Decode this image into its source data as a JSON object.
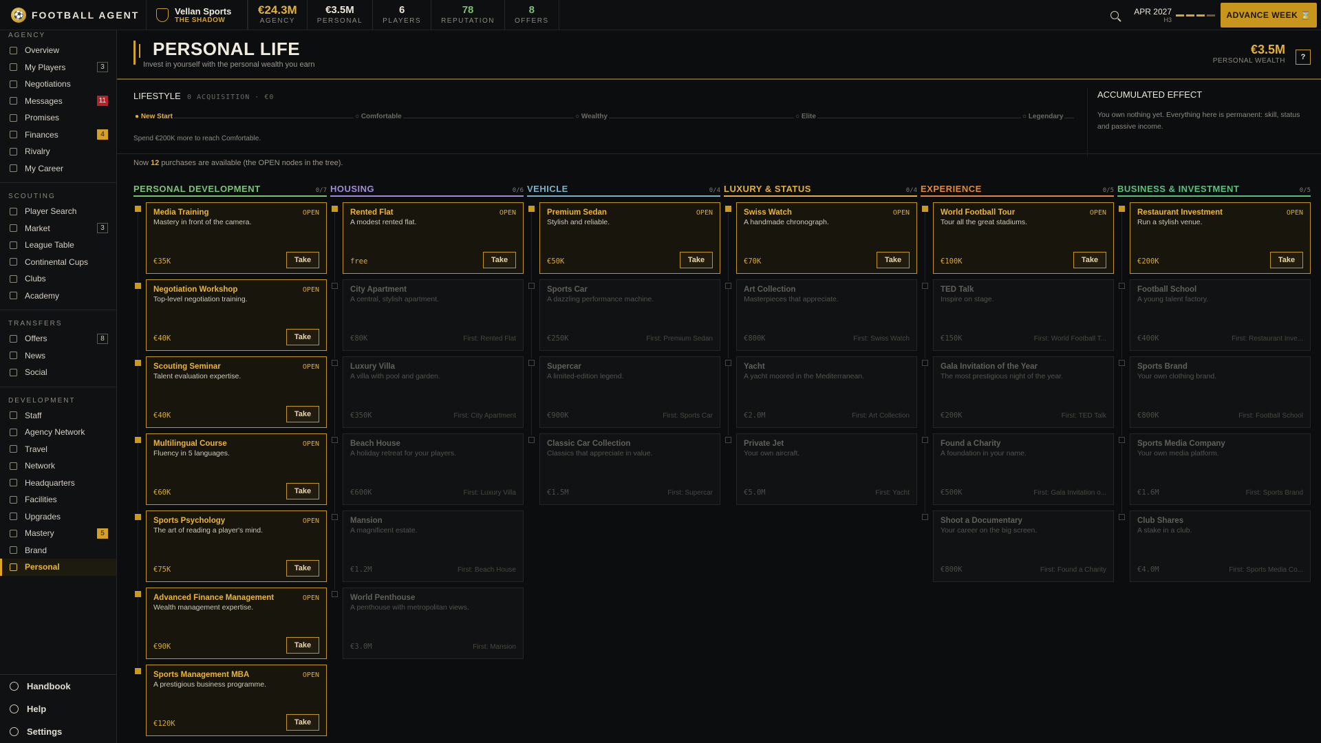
{
  "app": {
    "name": "FOOTBALL AGENT"
  },
  "agency": {
    "name": "Vellan Sports",
    "alias": "THE SHADOW"
  },
  "stats": [
    {
      "value": "€24.3M",
      "label": "AGENCY",
      "style": "gold"
    },
    {
      "value": "€3.5M",
      "label": "PERSONAL",
      "style": ""
    },
    {
      "value": "6",
      "label": "PLAYERS",
      "style": ""
    },
    {
      "value": "78",
      "label": "REPUTATION",
      "style": "green"
    },
    {
      "value": "8",
      "label": "OFFERS",
      "style": "green"
    }
  ],
  "date": {
    "main": "APR 2027",
    "sub": "H3"
  },
  "advance_label": "ADVANCE WEEK",
  "sidebar": {
    "sections": [
      {
        "title": "AGENCY",
        "items": [
          {
            "label": "Overview",
            "icon": "grid-icon"
          },
          {
            "label": "My Players",
            "icon": "user-icon",
            "badge": "3"
          },
          {
            "label": "Negotiations",
            "icon": "chat-icon"
          },
          {
            "label": "Messages",
            "icon": "mail-icon",
            "badge": "11",
            "badge_style": "red"
          },
          {
            "label": "Promises",
            "icon": "link-icon"
          },
          {
            "label": "Finances",
            "icon": "coin-icon",
            "badge": "4",
            "badge_style": "gold"
          },
          {
            "label": "Rivalry",
            "icon": "swords-icon"
          },
          {
            "label": "My Career",
            "icon": "medal-icon"
          }
        ]
      },
      {
        "title": "SCOUTING",
        "items": [
          {
            "label": "Player Search",
            "icon": "search-icon"
          },
          {
            "label": "Market",
            "icon": "cart-icon",
            "badge": "3"
          },
          {
            "label": "League Table",
            "icon": "table-icon"
          },
          {
            "label": "Continental Cups",
            "icon": "trophy-icon"
          },
          {
            "label": "Clubs",
            "icon": "shield-icon"
          },
          {
            "label": "Academy",
            "icon": "cap-icon"
          }
        ]
      },
      {
        "title": "TRANSFERS",
        "items": [
          {
            "label": "Offers",
            "icon": "transfer-icon",
            "badge": "8"
          },
          {
            "label": "News",
            "icon": "globe-icon"
          },
          {
            "label": "Social",
            "icon": "social-icon"
          }
        ]
      },
      {
        "title": "DEVELOPMENT",
        "items": [
          {
            "label": "Staff",
            "icon": "staff-icon"
          },
          {
            "label": "Agency Network",
            "icon": "network-icon"
          },
          {
            "label": "Travel",
            "icon": "plane-icon"
          },
          {
            "label": "Network",
            "icon": "nodes-icon"
          },
          {
            "label": "Headquarters",
            "icon": "building-icon"
          },
          {
            "label": "Facilities",
            "icon": "dumbbell-icon"
          },
          {
            "label": "Upgrades",
            "icon": "trend-icon"
          },
          {
            "label": "Mastery",
            "icon": "chevrons-icon",
            "badge": "5",
            "badge_style": "gold"
          },
          {
            "label": "Brand",
            "icon": "star-icon"
          },
          {
            "label": "Personal",
            "icon": "gem-icon",
            "active": true
          }
        ]
      }
    ],
    "bottom": [
      {
        "label": "Handbook",
        "icon": "book-icon"
      },
      {
        "label": "Help",
        "icon": "help-icon"
      },
      {
        "label": "Settings",
        "icon": "gear-icon"
      }
    ]
  },
  "page": {
    "title": "PERSONAL LIFE",
    "subtitle": "Invest in yourself with the personal wealth you earn",
    "wealth_value": "€3.5M",
    "wealth_label": "PERSONAL WEALTH",
    "help_label": "?"
  },
  "lifestyle": {
    "title": "LIFESTYLE",
    "sub": "0 ACQUISITION · €0",
    "steps": [
      "● New Start",
      "○ Comfortable",
      "○ Wealthy",
      "○ Elite",
      "○ Legendary"
    ],
    "note": "Spend €200K more to reach Comfortable.",
    "now_prefix": "Now",
    "now_count": "12",
    "now_suffix": "purchases are available (the OPEN nodes in the tree)."
  },
  "accumulated": {
    "title": "ACCUMULATED EFFECT",
    "text": "You own nothing yet. Everything here is permanent: skill, status and passive income."
  },
  "labels": {
    "open": "OPEN",
    "take": "Take"
  },
  "columns": [
    {
      "name": "PERSONAL DEVELOPMENT",
      "count": "0/7",
      "color": "#7ec27a",
      "nodes": [
        {
          "title": "Media Training",
          "desc": "Mastery in front of the camera.",
          "price": "€35K",
          "open": true
        },
        {
          "title": "Negotiation Workshop",
          "desc": "Top-level negotiation training.",
          "price": "€40K",
          "open": true
        },
        {
          "title": "Scouting Seminar",
          "desc": "Talent evaluation expertise.",
          "price": "€40K",
          "open": true
        },
        {
          "title": "Multilingual Course",
          "desc": "Fluency in 5 languages.",
          "price": "€60K",
          "open": true
        },
        {
          "title": "Sports Psychology",
          "desc": "The art of reading a player's mind.",
          "price": "€75K",
          "open": true
        },
        {
          "title": "Advanced Finance Management",
          "desc": "Wealth management expertise.",
          "price": "€90K",
          "open": true
        },
        {
          "title": "Sports Management MBA",
          "desc": "A prestigious business programme.",
          "price": "€120K",
          "open": true
        }
      ]
    },
    {
      "name": "HOUSING",
      "count": "0/6",
      "color": "#a48bd6",
      "nodes": [
        {
          "title": "Rented Flat",
          "desc": "A modest rented flat.",
          "price": "free",
          "open": true
        },
        {
          "title": "City Apartment",
          "desc": "A central, stylish apartment.",
          "price": "€80K",
          "req": "First: Rented Flat"
        },
        {
          "title": "Luxury Villa",
          "desc": "A villa with pool and garden.",
          "price": "€350K",
          "req": "First: City Apartment"
        },
        {
          "title": "Beach House",
          "desc": "A holiday retreat for your players.",
          "price": "€600K",
          "req": "First: Luxury Villa"
        },
        {
          "title": "Mansion",
          "desc": "A magnificent estate.",
          "price": "€1.2M",
          "req": "First: Beach House"
        },
        {
          "title": "World Penthouse",
          "desc": "A penthouse with metropolitan views.",
          "price": "€3.0M",
          "req": "First: Mansion"
        }
      ]
    },
    {
      "name": "VEHICLE",
      "count": "0/4",
      "color": "#7fb0c8",
      "nodes": [
        {
          "title": "Premium Sedan",
          "desc": "Stylish and reliable.",
          "price": "€50K",
          "open": true
        },
        {
          "title": "Sports Car",
          "desc": "A dazzling performance machine.",
          "price": "€250K",
          "req": "First: Premium Sedan"
        },
        {
          "title": "Supercar",
          "desc": "A limited-edition legend.",
          "price": "€900K",
          "req": "First: Sports Car"
        },
        {
          "title": "Classic Car Collection",
          "desc": "Classics that appreciate in value.",
          "price": "€1.5M",
          "req": "First: Supercar"
        }
      ]
    },
    {
      "name": "LUXURY & STATUS",
      "count": "0/4",
      "color": "#e3b23c",
      "nodes": [
        {
          "title": "Swiss Watch",
          "desc": "A handmade chronograph.",
          "price": "€70K",
          "open": true
        },
        {
          "title": "Art Collection",
          "desc": "Masterpieces that appreciate.",
          "price": "€800K",
          "req": "First: Swiss Watch"
        },
        {
          "title": "Yacht",
          "desc": "A yacht moored in the Mediterranean.",
          "price": "€2.0M",
          "req": "First: Art Collection"
        },
        {
          "title": "Private Jet",
          "desc": "Your own aircraft.",
          "price": "€5.0M",
          "req": "First: Yacht"
        }
      ]
    },
    {
      "name": "EXPERIENCE",
      "count": "0/5",
      "color": "#e08a3a",
      "nodes": [
        {
          "title": "World Football Tour",
          "desc": "Tour all the great stadiums.",
          "price": "€100K",
          "open": true
        },
        {
          "title": "TED Talk",
          "desc": "Inspire on stage.",
          "price": "€150K",
          "req": "First: World Football T..."
        },
        {
          "title": "Gala Invitation of the Year",
          "desc": "The most prestigious night of the year.",
          "price": "€200K",
          "req": "First: TED Talk"
        },
        {
          "title": "Found a Charity",
          "desc": "A foundation in your name.",
          "price": "€500K",
          "req": "First: Gala Invitation o..."
        },
        {
          "title": "Shoot a Documentary",
          "desc": "Your career on the big screen.",
          "price": "€800K",
          "req": "First: Found a Charity"
        }
      ]
    },
    {
      "name": "BUSINESS & INVESTMENT",
      "count": "0/5",
      "color": "#5cc07f",
      "nodes": [
        {
          "title": "Restaurant Investment",
          "desc": "Run a stylish venue.",
          "price": "€200K",
          "open": true
        },
        {
          "title": "Football School",
          "desc": "A young talent factory.",
          "price": "€400K",
          "req": "First: Restaurant Inve..."
        },
        {
          "title": "Sports Brand",
          "desc": "Your own clothing brand.",
          "price": "€800K",
          "req": "First: Football School"
        },
        {
          "title": "Sports Media Company",
          "desc": "Your own media platform.",
          "price": "€1.6M",
          "req": "First: Sports Brand"
        },
        {
          "title": "Club Shares",
          "desc": "A stake in a club.",
          "price": "€4.0M",
          "req": "First: Sports Media Co..."
        }
      ]
    }
  ]
}
